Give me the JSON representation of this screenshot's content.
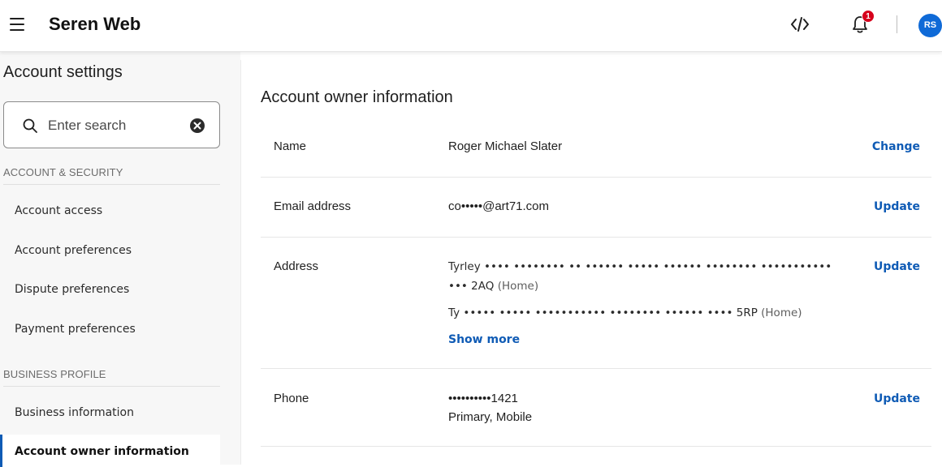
{
  "app": {
    "title": "Seren Web"
  },
  "header": {
    "notification_count": "1",
    "avatar_initials": "RS"
  },
  "sidebar": {
    "title": "Account settings",
    "search": {
      "placeholder": "Enter search",
      "value": ""
    },
    "sections": [
      {
        "header": "ACCOUNT & SECURITY",
        "items": [
          {
            "label": "Account access"
          },
          {
            "label": "Account preferences"
          },
          {
            "label": "Dispute preferences"
          },
          {
            "label": "Payment preferences"
          }
        ]
      },
      {
        "header": "BUSINESS PROFILE",
        "items": [
          {
            "label": "Business information"
          },
          {
            "label": "Account owner information",
            "active": true
          }
        ]
      }
    ]
  },
  "main": {
    "title": "Account owner information",
    "rows": {
      "name": {
        "label": "Name",
        "value": "Roger Michael Slater",
        "action": "Change"
      },
      "email": {
        "label": "Email address",
        "value": "co•••••@art71.com",
        "action": "Update"
      },
      "address": {
        "label": "Address",
        "line1": "Tyrley •••• •••••••• •• •••••• ••••• •••••• •••••••• •••••••••••",
        "line2": "••• 2AQ",
        "line2_tag": "(Home)",
        "line3": "Ty ••••• ••••• ••••••••••• •••••••• •••••• •••• 5RP",
        "line3_tag": "(Home)",
        "show_more": "Show more",
        "action": "Update"
      },
      "phone": {
        "label": "Phone",
        "value": "••••••••••1421",
        "subvalue": "Primary, Mobile",
        "action": "Update"
      }
    }
  },
  "colors": {
    "accent": "#0f5bb5",
    "badge": "#d6001c",
    "avatar": "#0f6ad7"
  }
}
